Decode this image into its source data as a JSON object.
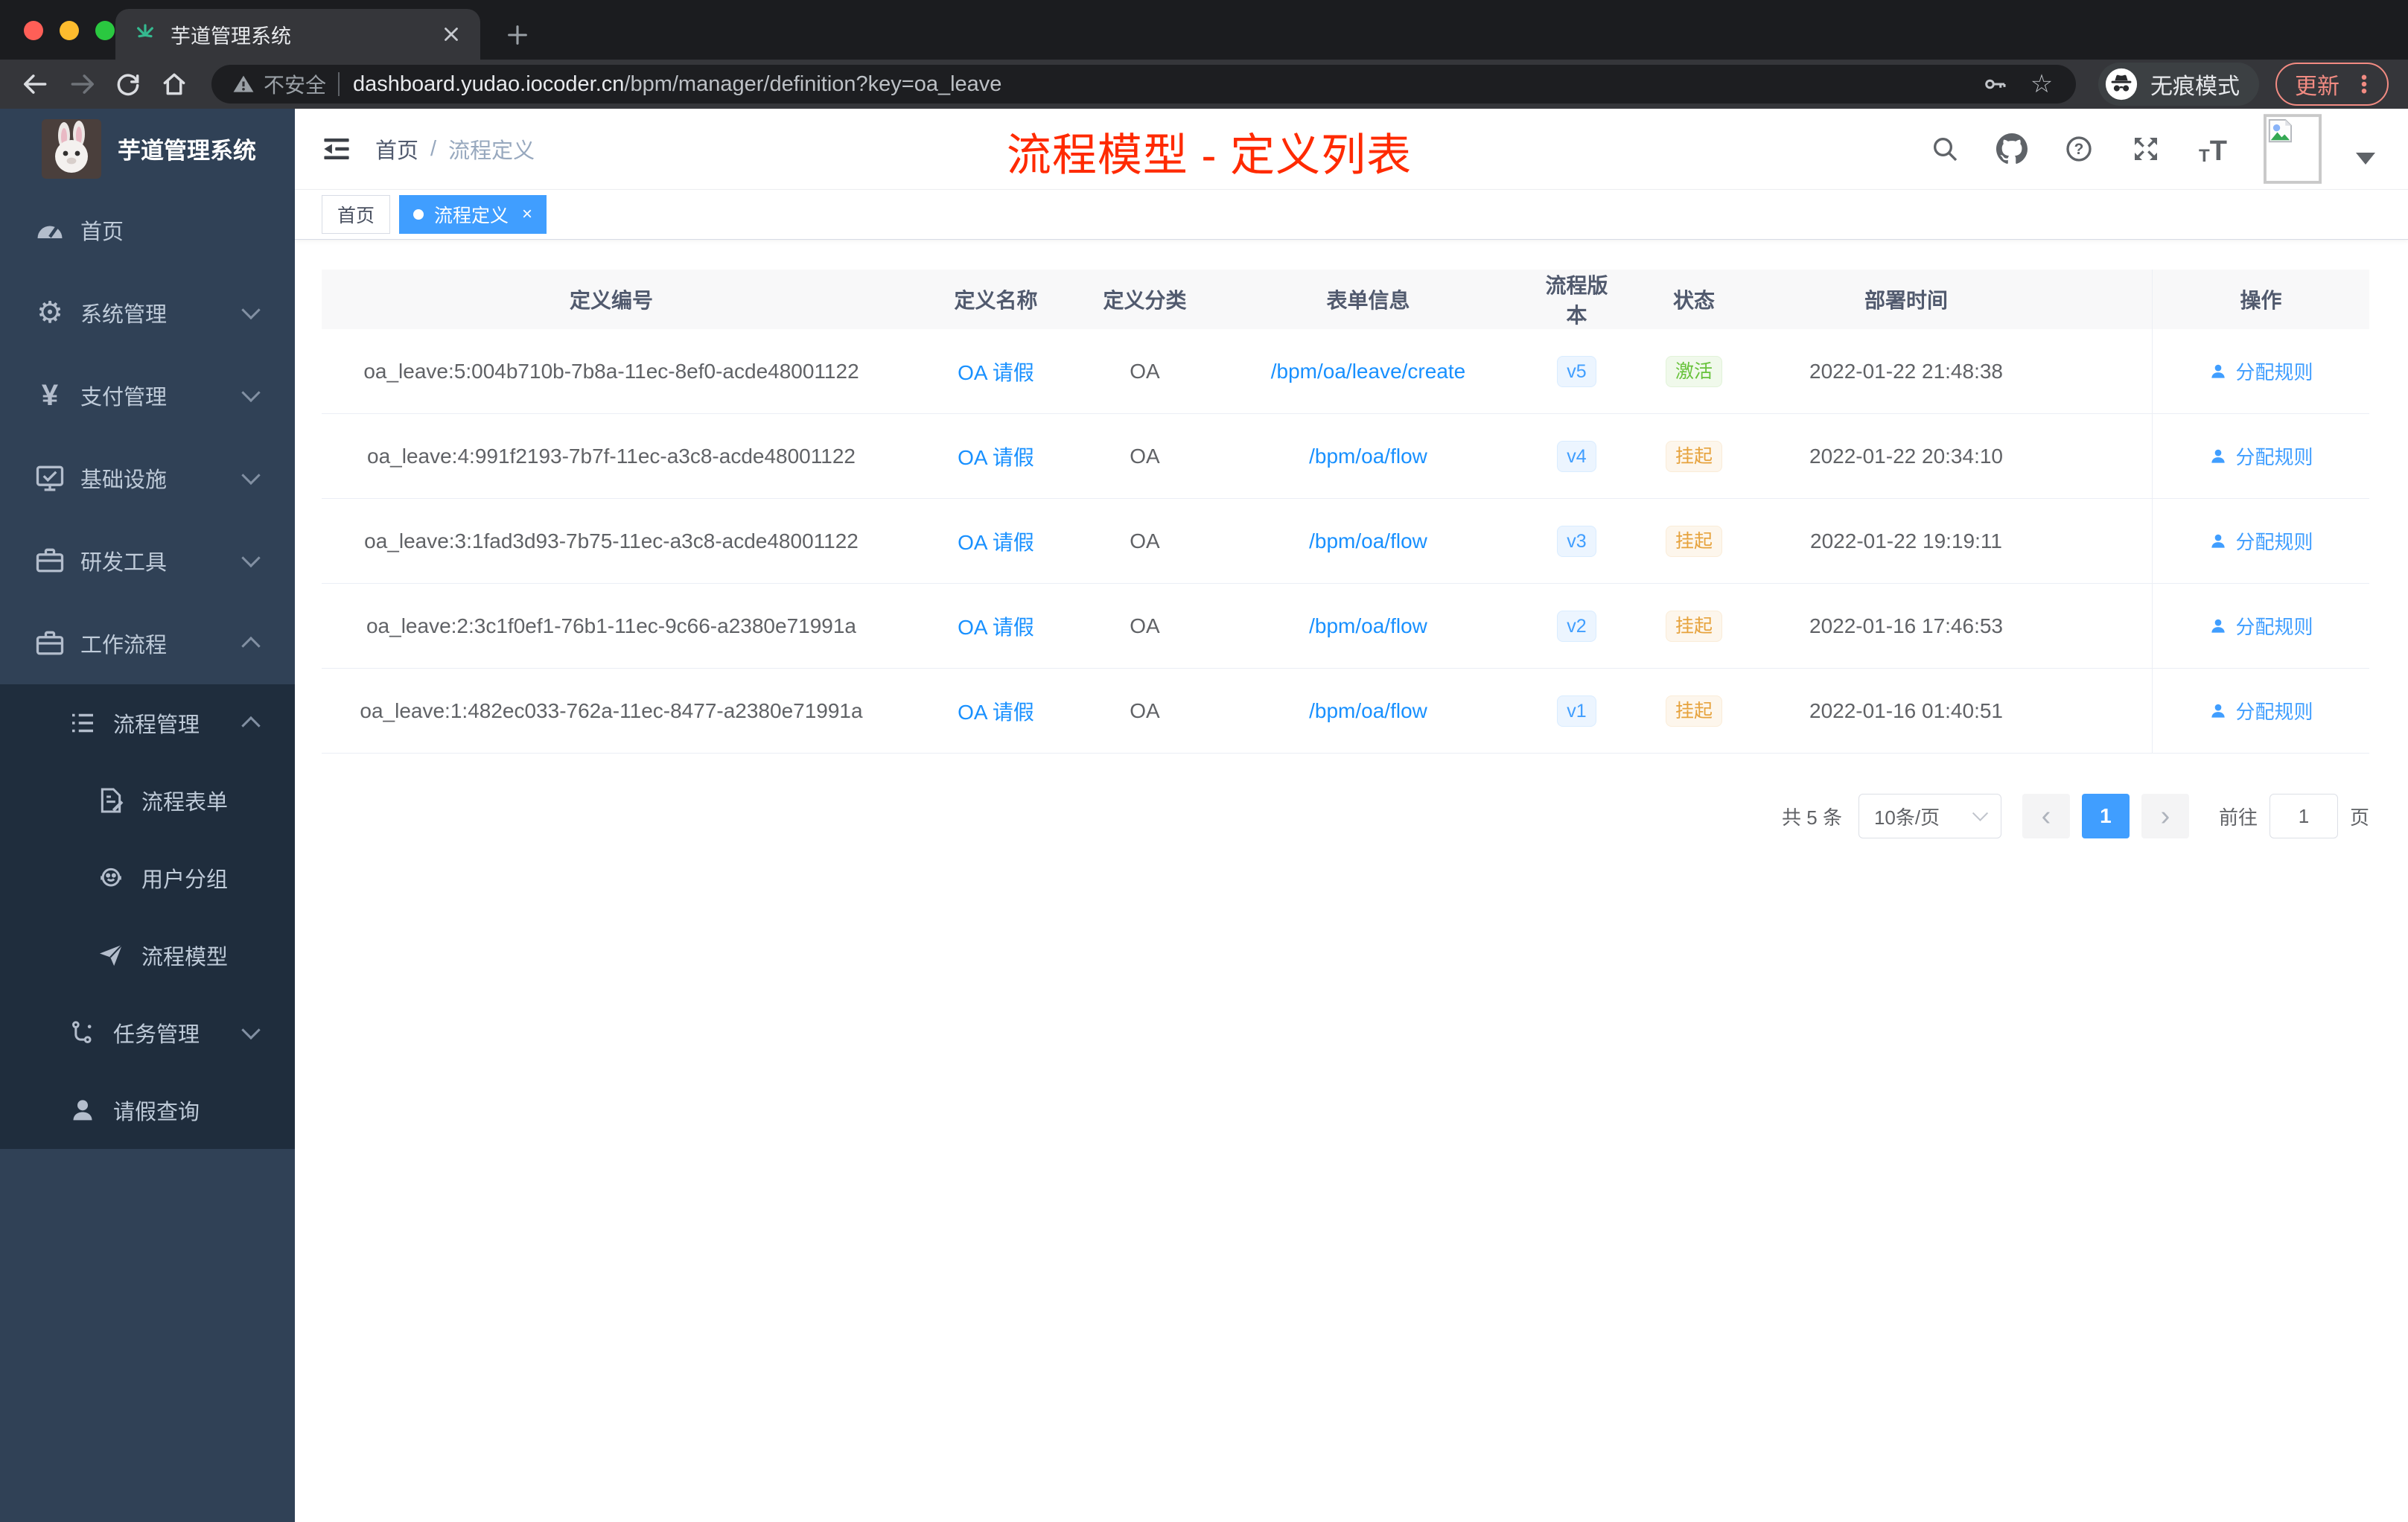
{
  "browser": {
    "tab_title": "芋道管理系统",
    "security_label": "不安全",
    "url_host": "dashboard.yudao.iocoder.cn",
    "url_path": "/bpm/manager/definition?key=oa_leave",
    "incognito_label": "无痕模式",
    "update_label": "更新"
  },
  "sidebar": {
    "app_title": "芋道管理系统",
    "items": [
      {
        "label": "首页"
      },
      {
        "label": "系统管理"
      },
      {
        "label": "支付管理"
      },
      {
        "label": "基础设施"
      },
      {
        "label": "研发工具"
      },
      {
        "label": "工作流程"
      },
      {
        "label": "流程管理"
      },
      {
        "label": "流程表单"
      },
      {
        "label": "用户分组"
      },
      {
        "label": "流程模型"
      },
      {
        "label": "任务管理"
      },
      {
        "label": "请假查询"
      }
    ]
  },
  "header": {
    "breadcrumb_home": "首页",
    "breadcrumb_separator": "/",
    "breadcrumb_current": "流程定义",
    "annotation": "流程模型 - 定义列表"
  },
  "tags": [
    {
      "label": "首页"
    },
    {
      "label": "流程定义"
    }
  ],
  "table": {
    "columns": {
      "id": "定义编号",
      "name": "定义名称",
      "category": "定义分类",
      "form": "表单信息",
      "version": "流程版本",
      "status": "状态",
      "time": "部署时间",
      "action": "操作"
    },
    "rows": [
      {
        "id": "oa_leave:5:004b710b-7b8a-11ec-8ef0-acde48001122",
        "name": "OA 请假",
        "category": "OA",
        "form": "/bpm/oa/leave/create",
        "version": "v5",
        "status": "激活",
        "status_class": "success",
        "time": "2022-01-22 21:48:38",
        "action": "分配规则"
      },
      {
        "id": "oa_leave:4:991f2193-7b7f-11ec-a3c8-acde48001122",
        "name": "OA 请假",
        "category": "OA",
        "form": "/bpm/oa/flow",
        "version": "v4",
        "status": "挂起",
        "status_class": "warning",
        "time": "2022-01-22 20:34:10",
        "action": "分配规则"
      },
      {
        "id": "oa_leave:3:1fad3d93-7b75-11ec-a3c8-acde48001122",
        "name": "OA 请假",
        "category": "OA",
        "form": "/bpm/oa/flow",
        "version": "v3",
        "status": "挂起",
        "status_class": "warning",
        "time": "2022-01-22 19:19:11",
        "action": "分配规则"
      },
      {
        "id": "oa_leave:2:3c1f0ef1-76b1-11ec-9c66-a2380e71991a",
        "name": "OA 请假",
        "category": "OA",
        "form": "/bpm/oa/flow",
        "version": "v2",
        "status": "挂起",
        "status_class": "warning",
        "time": "2022-01-16 17:46:53",
        "action": "分配规则"
      },
      {
        "id": "oa_leave:1:482ec033-762a-11ec-8477-a2380e71991a",
        "name": "OA 请假",
        "category": "OA",
        "form": "/bpm/oa/flow",
        "version": "v1",
        "status": "挂起",
        "status_class": "warning",
        "time": "2022-01-16 01:40:51",
        "action": "分配规则"
      }
    ]
  },
  "pagination": {
    "total": "共 5 条",
    "page_size": "10条/页",
    "prev": "‹",
    "next": "›",
    "current": "1",
    "goto_label": "前往",
    "goto_value": "1",
    "unit": "页"
  },
  "glyphs": {
    "question": "?",
    "gear": "⚙",
    "yen": "¥",
    "star": "☆",
    "font_small": "T",
    "font_large": "T"
  },
  "colors": {
    "accent_blue": "#409eff",
    "link_blue": "#1890ff",
    "annotation_red": "#ff2a00",
    "sidebar_bg": "#304156",
    "submenu_bg": "#1f2d3d",
    "success_green": "#67c23a",
    "warning_orange": "#e6a23c",
    "update_salmon": "#f28b82"
  }
}
